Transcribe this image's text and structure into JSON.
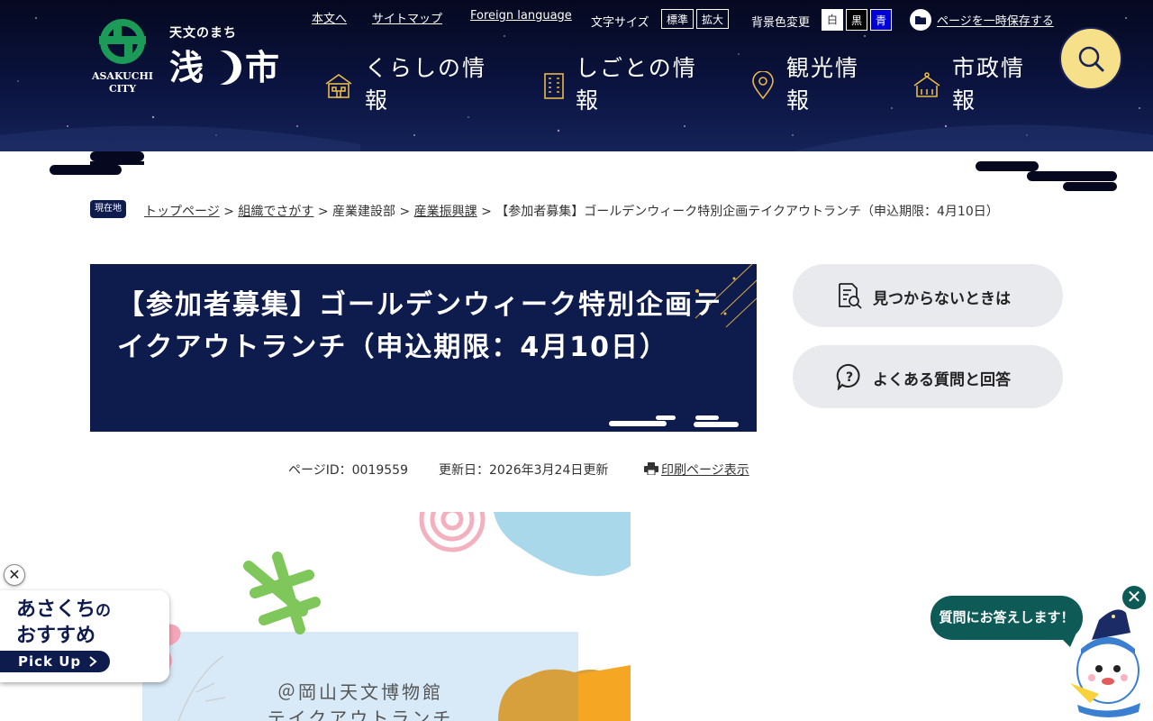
{
  "header": {
    "logo": {
      "tagline": "天文のまち",
      "name_before": "浅",
      "name_after": "市",
      "en_line1": "ASAKUCHI",
      "en_line2": "CITY"
    },
    "utility": {
      "skip": "本文へ",
      "sitemap": "サイトマップ",
      "foreign": "Foreign language",
      "font_size_label": "文字サイズ",
      "font_standard": "標準",
      "font_large": "拡大",
      "bg_color_label": "背景色変更",
      "bg_white": "白",
      "bg_black": "黒",
      "bg_blue": "青",
      "save_page": "ページを一時保存する"
    },
    "nav": [
      {
        "line1": "くらしの情",
        "line2": "報",
        "icon": "house-icon"
      },
      {
        "line1": "しごとの情",
        "line2": "報",
        "icon": "building-icon"
      },
      {
        "line1": "観光情",
        "line2": "報",
        "icon": "map-pin-icon"
      },
      {
        "line1": "市政情",
        "line2": "報",
        "icon": "city-hall-icon"
      }
    ],
    "search_icon": "search-icon"
  },
  "breadcrumb": {
    "here_label": "現在地",
    "items": [
      "トップページ",
      "組織でさがす",
      "産業建設部",
      "産業振興課"
    ],
    "current": "【参加者募集】ゴールデンウィーク特別企画テイクアウトランチ（申込期限：4月10日）",
    "separator": ">"
  },
  "article": {
    "title": "【参加者募集】ゴールデンウィーク特別企画テイクアウトランチ（申込期限：4月10日）",
    "page_id": "ページID：0019559",
    "updated": "更新日：2026年3月24日更新",
    "print": "印刷ページ表示",
    "image_text_line1": "＠岡山天文博物館",
    "image_text_line2": "テイクアウトランチ"
  },
  "sidebar": {
    "not_found": "見つからないときは",
    "faq": "よくある質問と回答"
  },
  "pickup": {
    "close": "✕",
    "title_part1": "あさくち",
    "title_part2": "の",
    "title_line2": "おすすめ",
    "button": "Pick Up"
  },
  "chat": {
    "bubble": "質問にお答えします！",
    "close": "✕"
  },
  "colors": {
    "navy": "#0e1b4d",
    "accent_yellow": "#f7e08a",
    "chat_teal": "#0d5a57",
    "sidebar_gray": "#e9eaee"
  }
}
